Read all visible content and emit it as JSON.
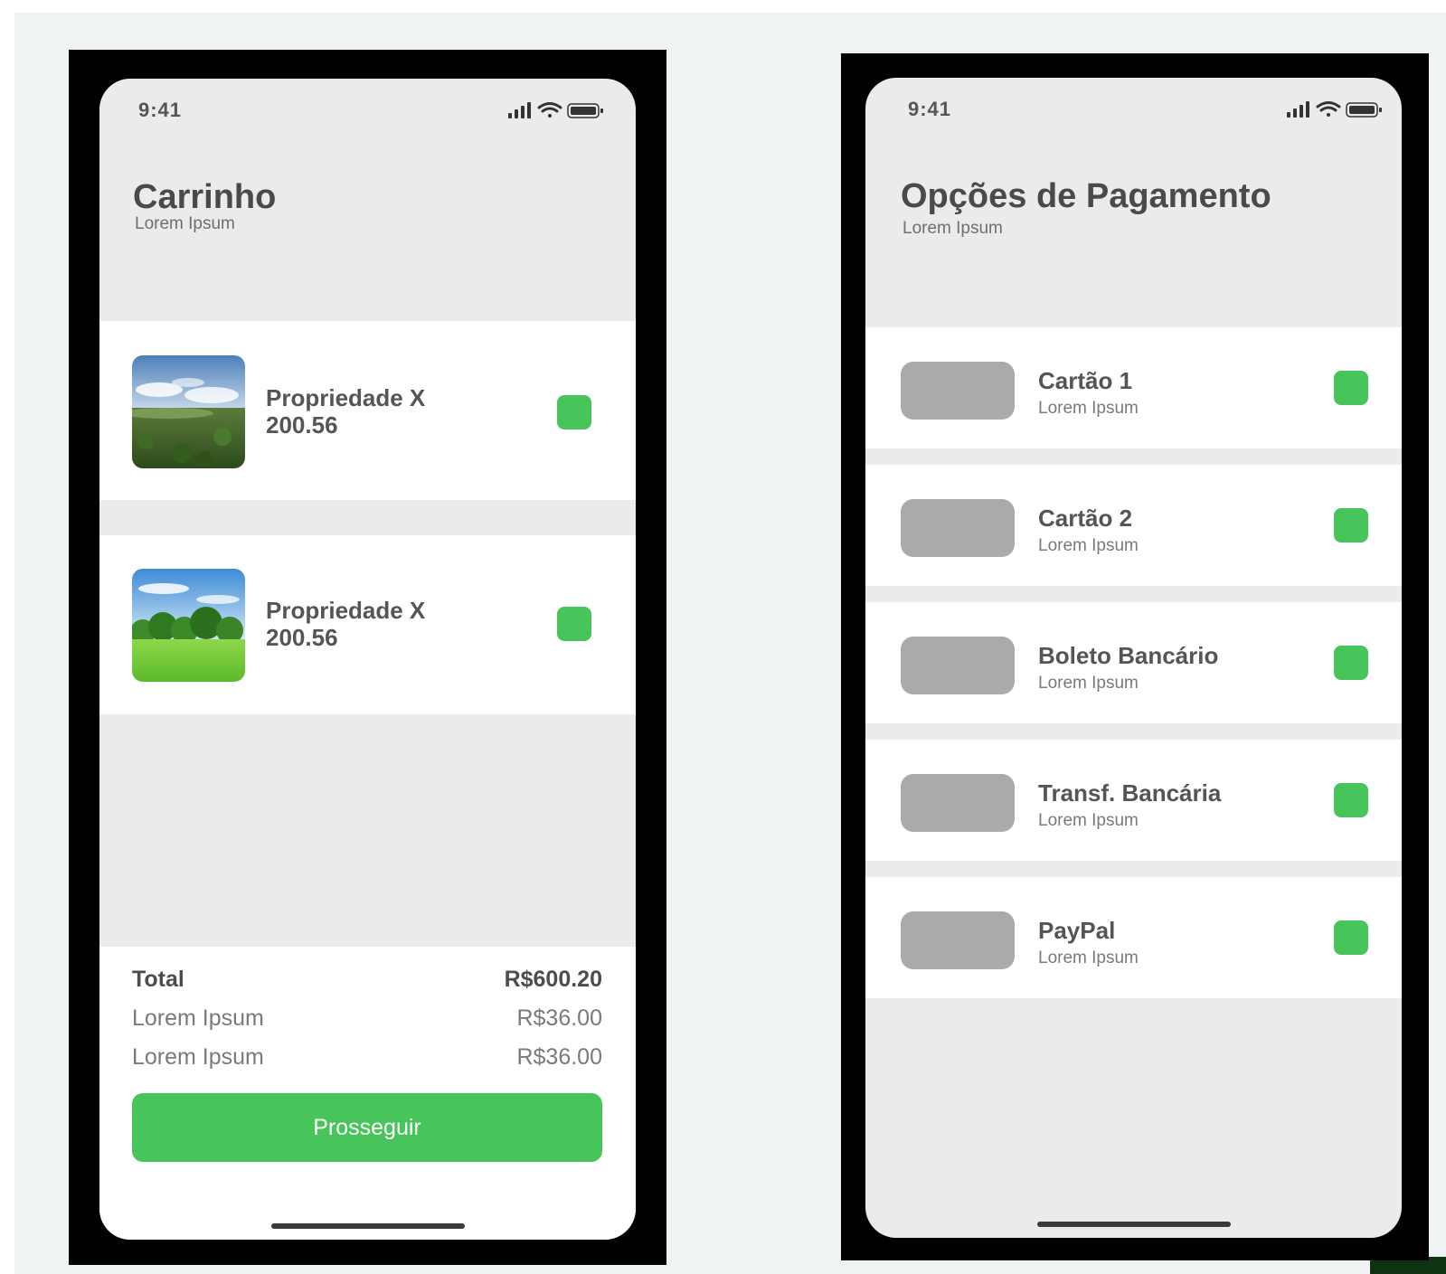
{
  "colors": {
    "accent_green": "#48c55a",
    "screen_background": "#ebebeb",
    "card_background": "#ffffff",
    "text_primary": "#555555",
    "placeholder_gray": "#aaaaaa"
  },
  "cart_screen": {
    "status_bar": {
      "time": "9:41",
      "icons": [
        "signal-icon",
        "wifi-icon",
        "battery-icon"
      ]
    },
    "header": {
      "title": "Carrinho",
      "subtitle": "Lorem Ipsum"
    },
    "items": [
      {
        "name": "Propriedade X",
        "price": "200.56",
        "image": "landscape-hills-photo"
      },
      {
        "name": "Propriedade X",
        "price": "200.56",
        "image": "landscape-meadow-photo"
      }
    ],
    "summary": {
      "total_label": "Total",
      "total_value": "R$600.20",
      "lines": [
        {
          "label": "Lorem Ipsum",
          "value": "R$36.00"
        },
        {
          "label": "Lorem Ipsum",
          "value": "R$36.00"
        }
      ]
    },
    "proceed_button": "Prosseguir"
  },
  "payment_screen": {
    "status_bar": {
      "time": "9:41",
      "icons": [
        "signal-icon",
        "wifi-icon",
        "battery-icon"
      ]
    },
    "header": {
      "title": "Opções de Pagamento",
      "subtitle": "Lorem Ipsum"
    },
    "options": [
      {
        "title": "Cartão 1",
        "subtitle": "Lorem Ipsum"
      },
      {
        "title": "Cartão 2",
        "subtitle": "Lorem Ipsum"
      },
      {
        "title": "Boleto Bancário",
        "subtitle": "Lorem Ipsum"
      },
      {
        "title": "Transf. Bancária",
        "subtitle": "Lorem Ipsum"
      },
      {
        "title": "PayPal",
        "subtitle": "Lorem Ipsum"
      }
    ]
  }
}
